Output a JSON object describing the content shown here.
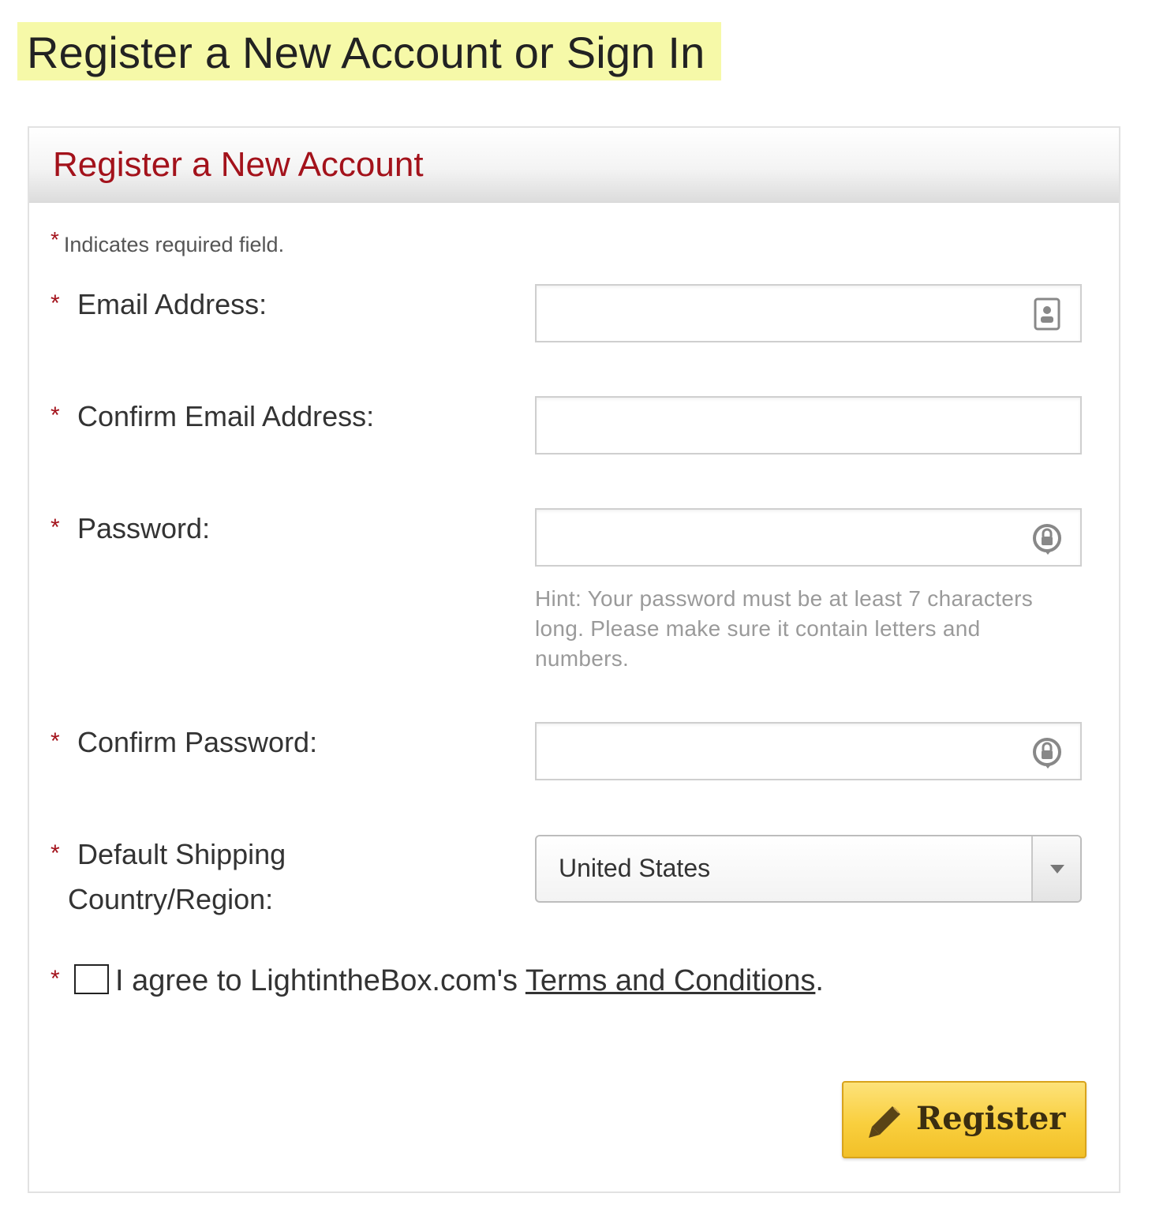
{
  "page": {
    "heading": "Register a New Account or Sign In"
  },
  "panel": {
    "title": "Register a New Account"
  },
  "required_note": {
    "star": "*",
    "text": "Indicates required field."
  },
  "fields": {
    "email": {
      "star": "*",
      "label": "Email Address:",
      "value": "",
      "icon": "contact-card-icon"
    },
    "confirm_email": {
      "star": "*",
      "label": "Confirm Email Address:",
      "value": ""
    },
    "password": {
      "star": "*",
      "label": "Password:",
      "value": "",
      "icon": "password-manager-icon",
      "hint": "Hint: Your password must be at least 7 characters long. Please make sure it contain letters and numbers."
    },
    "confirm_password": {
      "star": "*",
      "label": "Confirm Password:",
      "value": "",
      "icon": "password-manager-icon"
    },
    "country": {
      "star": "*",
      "label_line1": "Default Shipping",
      "label_line2": "Country/Region:",
      "selected": "United States"
    }
  },
  "agreement": {
    "star": "*",
    "text": "I agree to LightintheBox.com's ",
    "link": "Terms and Conditions",
    "suffix": ".",
    "checked": false
  },
  "register_button": {
    "label": "Register",
    "icon": "pencil-icon"
  },
  "colors": {
    "accent_red": "#a3121b",
    "heading_highlight": "#f6f9a8",
    "button_yellow": "#f9cf3e"
  }
}
